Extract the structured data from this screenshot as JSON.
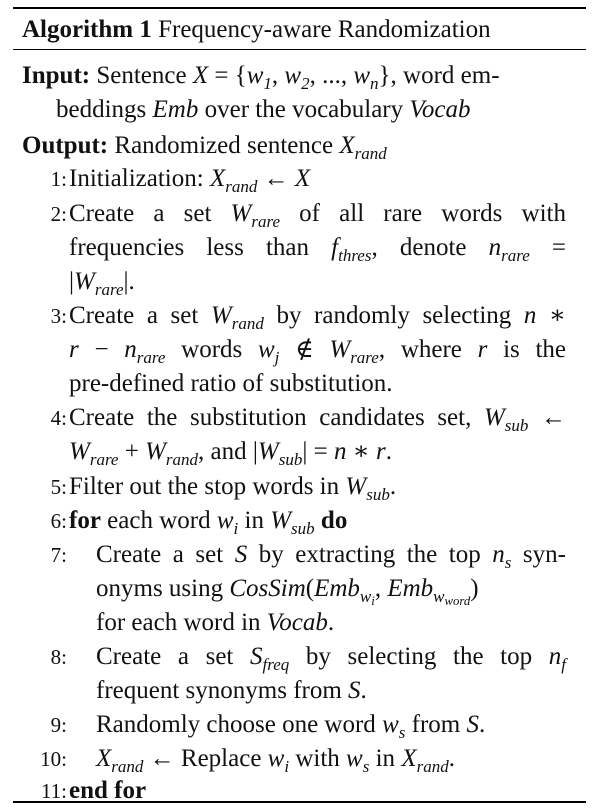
{
  "algorithm": {
    "label": "Algorithm 1",
    "title": "Frequency-aware Randomization"
  },
  "io": {
    "input_label": "Input:",
    "input_l1_pre": "Sentence ",
    "input_l1_post": ", word em-",
    "input_l2_pre": "beddings ",
    "input_l2_mid": " over the vocabulary ",
    "output_label": "Output:",
    "output_pre": "Randomized sentence "
  },
  "steps": [
    {
      "num": "1:",
      "lines": [
        "Initialization: "
      ]
    },
    {
      "num": "2:",
      "lines": [
        "Create a set ",
        " of all rare words with",
        "frequencies less than ",
        ", denote ",
        "."
      ]
    },
    {
      "num": "3:",
      "lines": [
        "Create a set ",
        " by randomly selecting ",
        " words ",
        ", where ",
        " is the",
        "pre-defined ratio of substitution."
      ]
    },
    {
      "num": "4:",
      "lines": [
        "Create the substitution candidates set, ",
        ", and ",
        "."
      ]
    },
    {
      "num": "5:",
      "lines": [
        "Filter out the stop words in ",
        "."
      ]
    },
    {
      "num": "6:",
      "lines": [
        "for",
        " each word ",
        " in ",
        "do"
      ]
    },
    {
      "num": "7:",
      "lines": [
        "Create a set ",
        " by extracting the top ",
        " syn-",
        "onyms using ",
        "for each word in ",
        "."
      ]
    },
    {
      "num": "8:",
      "lines": [
        "Create a set ",
        " by selecting the top ",
        "frequent synonyms from ",
        "."
      ]
    },
    {
      "num": "9:",
      "lines": [
        "Randomly choose one word ",
        " from ",
        "."
      ]
    },
    {
      "num": "10:",
      "lines": [
        " Replace ",
        " with ",
        " in ",
        "."
      ]
    },
    {
      "num": "11:",
      "lines": [
        "end for"
      ]
    }
  ]
}
